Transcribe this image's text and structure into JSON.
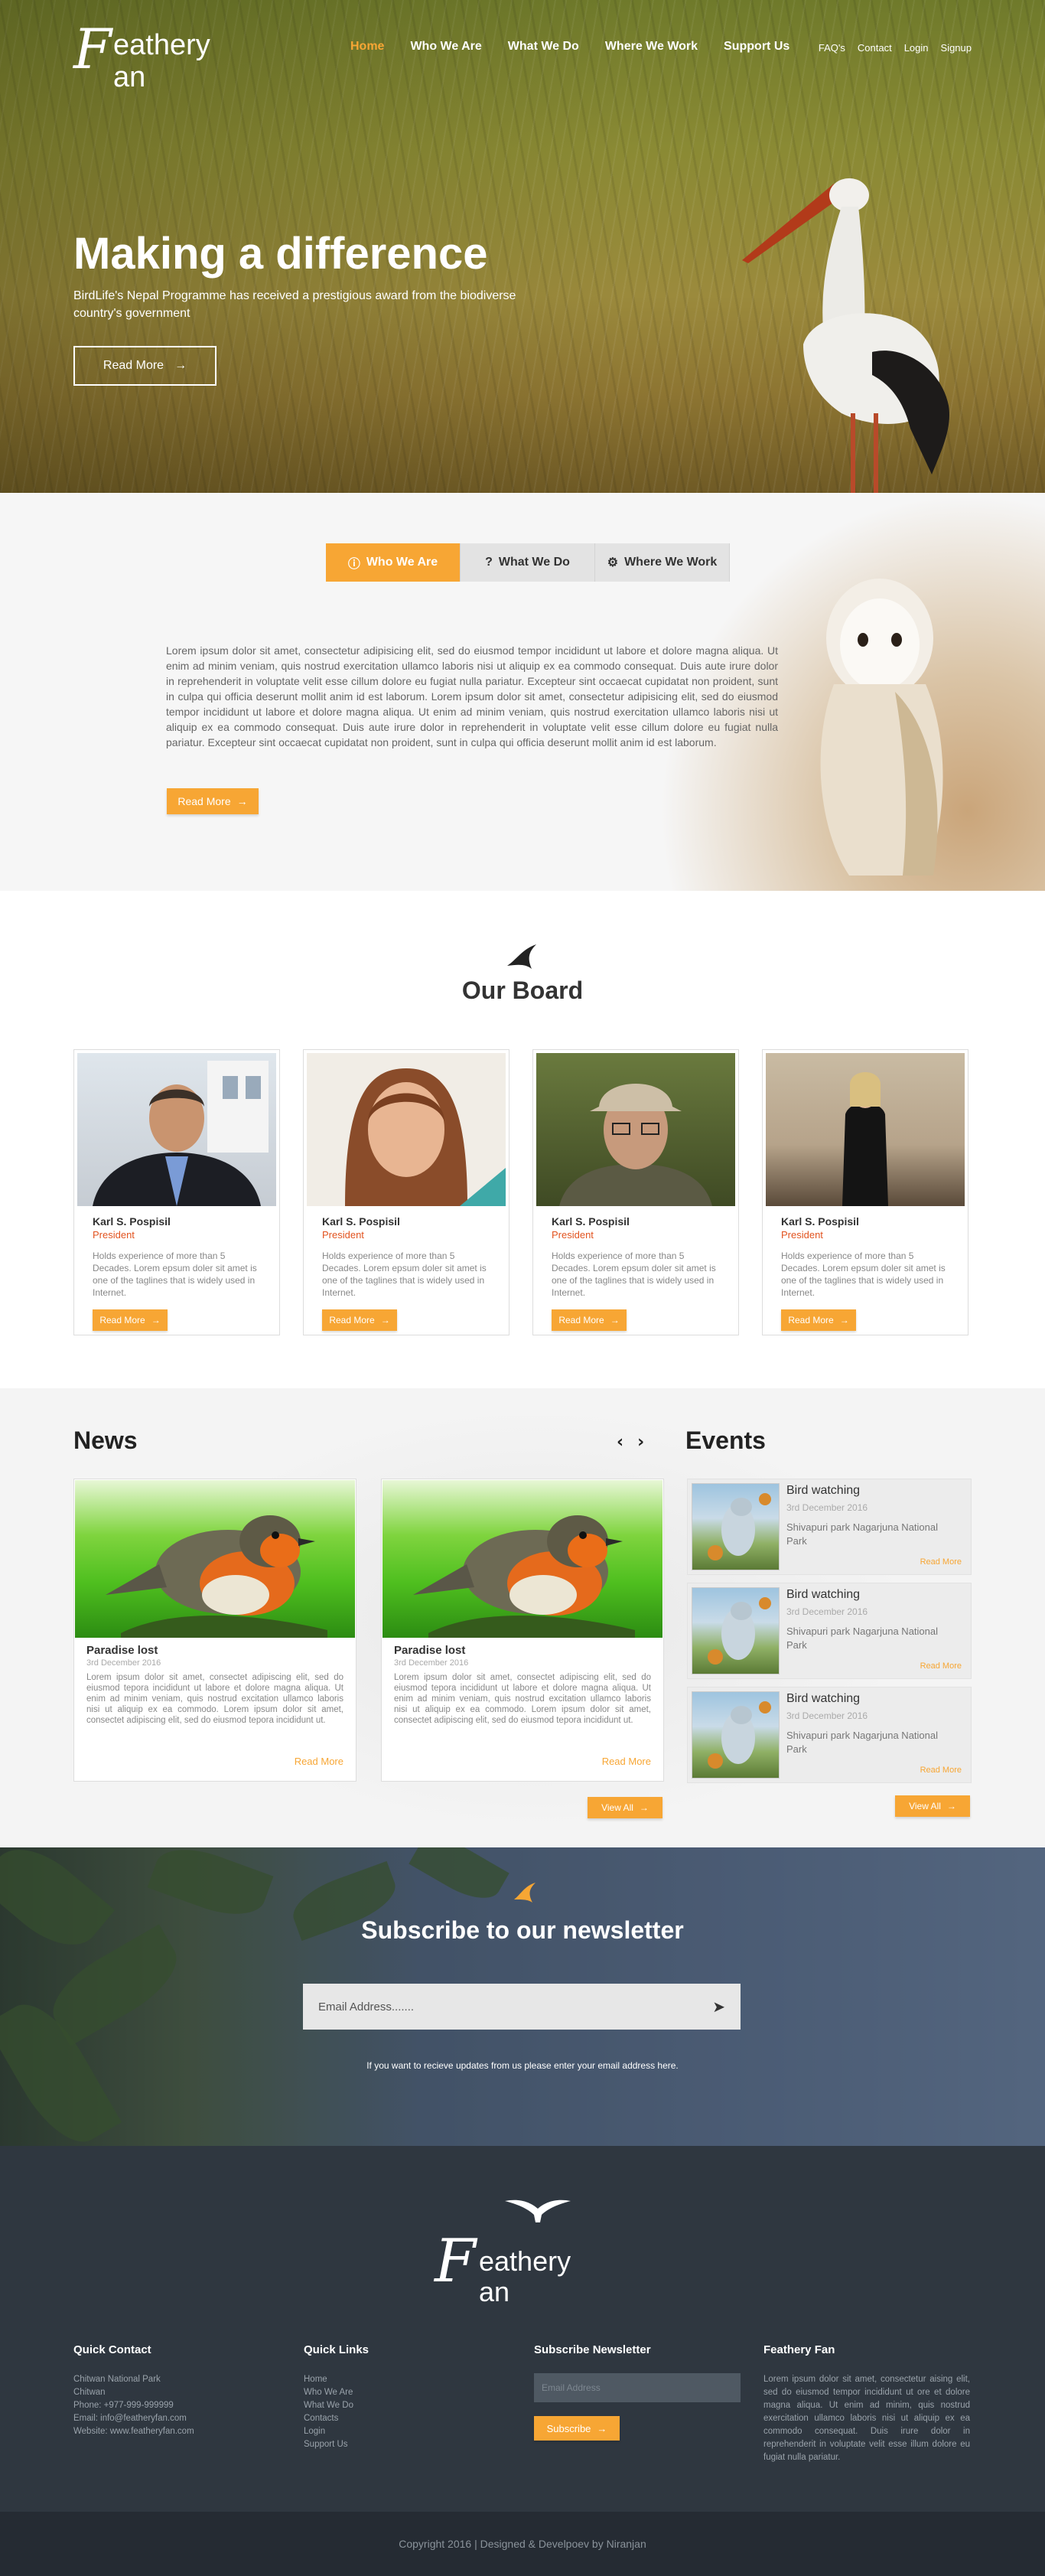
{
  "brand": {
    "logo_big": "F",
    "logo_top": "eathery",
    "logo_bottom": "an"
  },
  "nav": {
    "items": [
      "Home",
      "Who We Are",
      "What We Do",
      "Where We Work",
      "Support Us"
    ],
    "active": "Home",
    "top_links": [
      "FAQ's",
      "Contact",
      "Login",
      "Signup"
    ]
  },
  "hero": {
    "title": "Making a difference",
    "subtitle": "BirdLife's Nepal Programme has received a prestigious award from the biodiverse country's government",
    "button": "Read More"
  },
  "about": {
    "tabs": [
      {
        "label": "Who We Are",
        "icon": "info-circle-icon",
        "active": true
      },
      {
        "label": "What We Do",
        "icon": "question-circle-icon",
        "active": false
      },
      {
        "label": "Where We Work",
        "icon": "gear-icon",
        "active": false
      }
    ],
    "text": "Lorem ipsum dolor sit amet, consectetur adipisicing elit, sed do eiusmod tempor incididunt ut labore et dolore magna aliqua. Ut enim ad minim veniam, quis nostrud exercitation ullamco laboris nisi ut aliquip ex ea commodo consequat. Duis aute irure dolor in reprehenderit in voluptate velit esse cillum dolore eu fugiat nulla pariatur. Excepteur sint occaecat cupidatat non proident, sunt in culpa qui officia deserunt mollit anim id est laborum. Lorem ipsum dolor sit amet, consectetur adipisicing elit, sed do eiusmod tempor incididunt ut labore et dolore magna aliqua. Ut enim ad minim veniam, quis nostrud exercitation ullamco laboris nisi ut aliquip ex ea commodo consequat. Duis aute irure dolor in reprehenderit in voluptate velit esse cillum dolore eu fugiat nulla pariatur. Excepteur sint occaecat cupidatat non proident, sunt in culpa qui officia deserunt mollit anim id est laborum.",
    "button": "Read More"
  },
  "board": {
    "title": "Our Board",
    "members": [
      {
        "name": "Karl S. Pospisil",
        "role": "President",
        "desc": "Holds experience of more than 5 Decades. Lorem epsum doler sit amet is one of the taglines that is widely used in Internet.",
        "button": "Read More"
      },
      {
        "name": "Karl S. Pospisil",
        "role": "President",
        "desc": "Holds experience of more than 5 Decades. Lorem epsum doler sit amet is one of the taglines that is widely used in Internet.",
        "button": "Read More"
      },
      {
        "name": "Karl S. Pospisil",
        "role": "President",
        "desc": "Holds experience of more than 5 Decades. Lorem epsum doler sit amet is one of the taglines that is widely used in Internet.",
        "button": "Read More"
      },
      {
        "name": "Karl S. Pospisil",
        "role": "President",
        "desc": "Holds experience of more than 5 Decades. Lorem epsum doler sit amet is one of the taglines that is widely used in Internet.",
        "button": "Read More"
      }
    ]
  },
  "news": {
    "title": "News",
    "items": [
      {
        "title": "Paradise lost",
        "date": "3rd December 2016",
        "text": "Lorem ipsum dolor sit amet, consectet adipiscing elit, sed do eiusmod tepora incididunt ut labore et dolore magna aliqua. Ut enim ad minim veniam, quis nostrud excitation ullamco laboris nisi ut aliquip ex ea commodo. Lorem ipsum dolor sit amet, consectet adipiscing elit, sed do eiusmod tepora incididunt ut.",
        "more": "Read More"
      },
      {
        "title": "Paradise lost",
        "date": "3rd December 2016",
        "text": "Lorem ipsum dolor sit amet, consectet adipiscing elit, sed do eiusmod tepora incididunt ut labore et dolore magna aliqua. Ut enim ad minim veniam, quis nostrud excitation ullamco laboris nisi ut aliquip ex ea commodo. Lorem ipsum dolor sit amet, consectet adipiscing elit, sed do eiusmod tepora incididunt ut.",
        "more": "Read More"
      }
    ],
    "view_all": "View All"
  },
  "events": {
    "title": "Events",
    "items": [
      {
        "title": "Bird watching",
        "date": "3rd December 2016",
        "location": "Shivapuri park Nagarjuna National Park",
        "more": "Read More"
      },
      {
        "title": "Bird watching",
        "date": "3rd December 2016",
        "location": "Shivapuri park Nagarjuna National Park",
        "more": "Read More"
      },
      {
        "title": "Bird watching",
        "date": "3rd December 2016",
        "location": "Shivapuri park Nagarjuna National Park",
        "more": "Read More"
      }
    ],
    "view_all": "View All"
  },
  "subscribe": {
    "title_bold": "Subscribe",
    "title_rest": " to our newsletter",
    "placeholder": "Email Address.......",
    "note": "If you want to recieve updates from us please enter your email address here."
  },
  "footer": {
    "quick_contact": {
      "title": "Quick Contact",
      "lines": [
        "Chitwan National Park",
        "Chitwan",
        "Phone: +977-999-999999",
        "Email: info@featheryfan.com",
        "Website: www.featheryfan.com"
      ]
    },
    "quick_links": {
      "title": "Quick Links",
      "links": [
        "Home",
        "Who We Are",
        "What We Do",
        "Contacts",
        "Login",
        "Support Us"
      ]
    },
    "newsletter": {
      "title": "Subscribe Newsletter",
      "placeholder": "Email Address",
      "button": "Subscribe"
    },
    "about": {
      "title": "Feathery Fan",
      "text": "Lorem ipsum dolor sit amet, consectetur aising elit, sed do eiusmod tempor incididunt ut ore et dolore magna aliqua. Ut enim ad minim, quis nostrud exercitation ullamco laboris nisi ut aliquip ex ea commodo consequat. Duis irure dolor in reprehenderit in voluptate velit esse illum dolore eu fugiat nulla pariatur."
    },
    "copyright": "Copyright 2016  |  Designed & Develpoev by Niranjan"
  },
  "colors": {
    "accent": "#f7a634",
    "footer_bg": "#2f3740",
    "copyright_bg": "#252b33",
    "role": "#e2531f"
  }
}
